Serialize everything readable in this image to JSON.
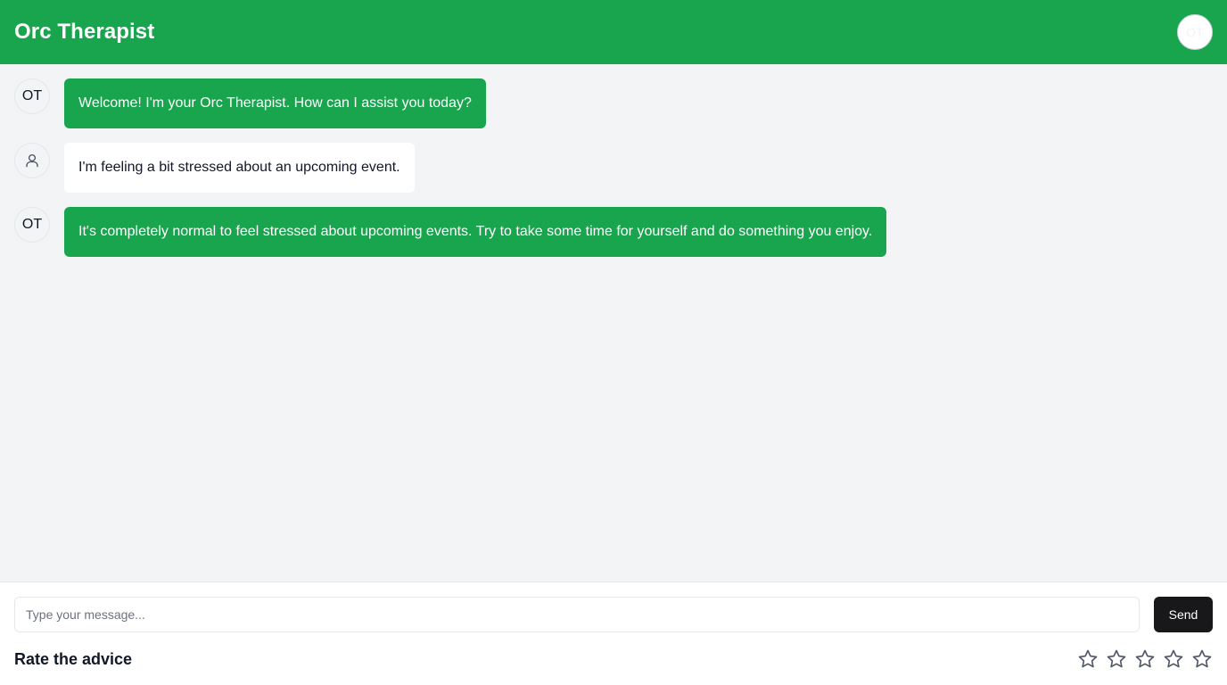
{
  "header": {
    "title": "Orc Therapist",
    "avatar_initials": "OT"
  },
  "messages": [
    {
      "sender": "bot",
      "avatar": "OT",
      "text": "Welcome! I'm your Orc Therapist. How can I assist you today?"
    },
    {
      "sender": "user",
      "avatar_icon": "user-icon",
      "text": "I'm feeling a bit stressed about an upcoming event."
    },
    {
      "sender": "bot",
      "avatar": "OT",
      "text": "It's completely normal to feel stressed about upcoming events. Try to take some time for yourself and do something you enjoy."
    }
  ],
  "composer": {
    "placeholder": "Type your message...",
    "value": "",
    "send_label": "Send"
  },
  "rating": {
    "label": "Rate the advice",
    "max": 5,
    "value": 0,
    "icon": "star-icon"
  },
  "colors": {
    "brand": "#19a44e",
    "send_button": "#18181b",
    "background": "#f3f4f6"
  }
}
